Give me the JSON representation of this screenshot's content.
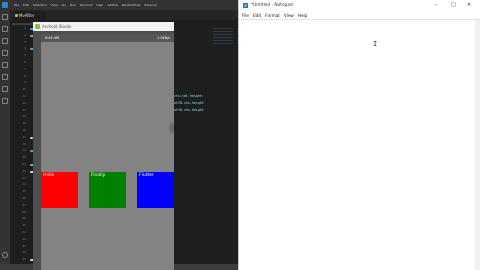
{
  "vscode": {
    "menu": [
      "File",
      "Edit",
      "Selection",
      "View",
      "Go",
      "Run",
      "Terminal",
      "Help",
      "GitHub",
      "RenderMode",
      "Explorer"
    ],
    "tab_label": "MvAfter",
    "line_numbers": [
      "1",
      "2",
      "3",
      "4",
      "5",
      "6",
      "7",
      "8",
      "9",
      "10",
      "11",
      "12",
      "13",
      "14",
      "15",
      "16",
      "17",
      "18",
      "19",
      "20",
      "21",
      "22",
      "23",
      "24",
      "25",
      "26",
      "27",
      "28",
      "29",
      "30",
      "31",
      "32",
      "33",
      "34",
      "35"
    ],
    "code_fragments": [
      "cts:cdt.height:",
      "utf8.chs.height",
      "utf8.chs.height"
    ]
  },
  "emulator": {
    "title": "Android Studio",
    "status_time": "8:44 AM",
    "status_right": "1.0KB/s",
    "boxes": [
      {
        "label": "Hello",
        "color": "#ff0000"
      },
      {
        "label": "Finally",
        "color": "#008000"
      },
      {
        "label": "Flutter",
        "color": "#0000ff"
      }
    ]
  },
  "notepad": {
    "title": "*Untitled - Notepad",
    "menu": [
      "File",
      "Edit",
      "Format",
      "View",
      "Help"
    ],
    "content": "I"
  }
}
